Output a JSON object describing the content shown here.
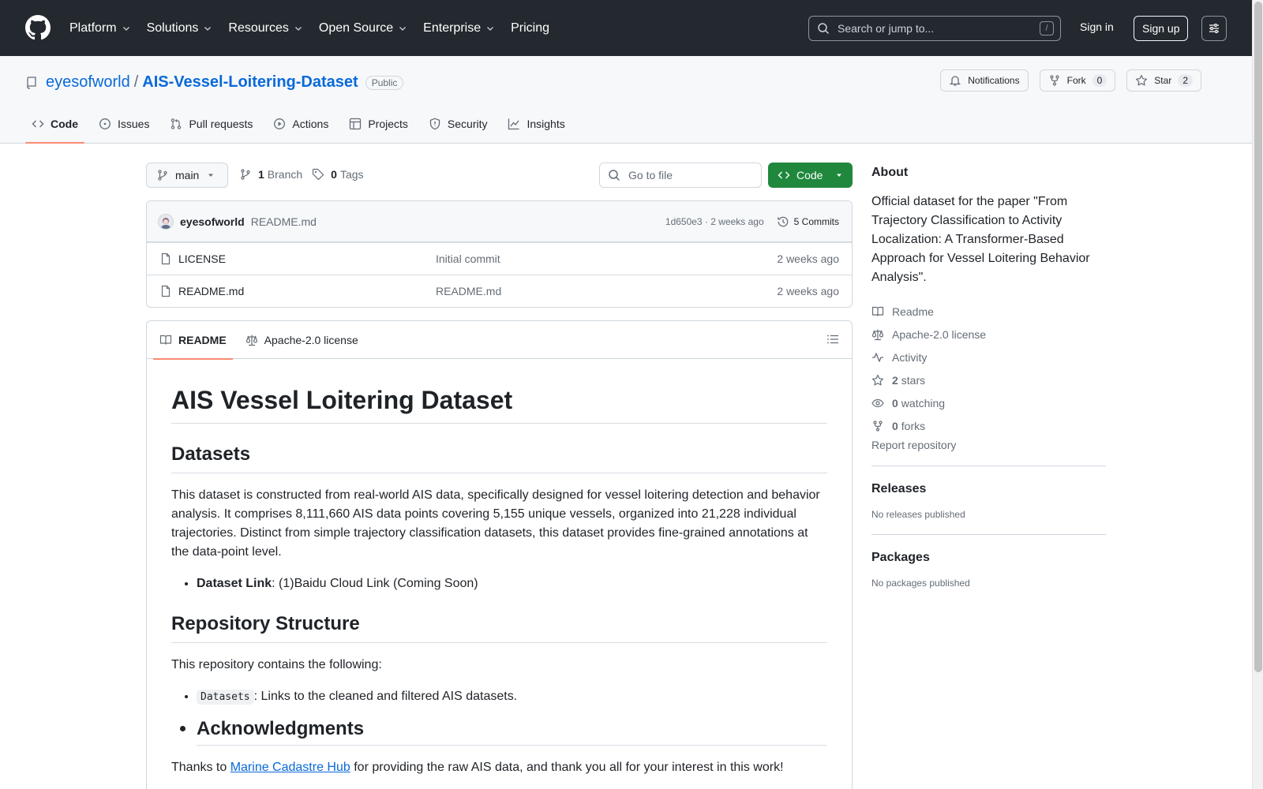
{
  "header": {
    "nav": [
      {
        "label": "Platform",
        "dropdown": true
      },
      {
        "label": "Solutions",
        "dropdown": true
      },
      {
        "label": "Resources",
        "dropdown": true
      },
      {
        "label": "Open Source",
        "dropdown": true
      },
      {
        "label": "Enterprise",
        "dropdown": true
      },
      {
        "label": "Pricing",
        "dropdown": false
      }
    ],
    "search_placeholder": "Search or jump to...",
    "search_shortcut": "/",
    "signin": "Sign in",
    "signup": "Sign up"
  },
  "repo": {
    "owner": "eyesofworld",
    "separator": "/",
    "name": "AIS-Vessel-Loitering-Dataset",
    "visibility": "Public",
    "notifications": "Notifications",
    "fork_label": "Fork",
    "fork_count": "0",
    "star_label": "Star",
    "star_count": "2",
    "tabs": [
      {
        "label": "Code",
        "icon": "code-icon"
      },
      {
        "label": "Issues",
        "icon": "issue-icon"
      },
      {
        "label": "Pull requests",
        "icon": "pull-request-icon"
      },
      {
        "label": "Actions",
        "icon": "play-icon"
      },
      {
        "label": "Projects",
        "icon": "table-icon"
      },
      {
        "label": "Security",
        "icon": "shield-icon"
      },
      {
        "label": "Insights",
        "icon": "graph-icon"
      }
    ]
  },
  "filenav": {
    "branch": "main",
    "branch_count": "1",
    "branch_label": "Branch",
    "tag_count": "0",
    "tag_label": "Tags",
    "goto_placeholder": "Go to file",
    "code_button": "Code"
  },
  "commit": {
    "author": "eyesofworld",
    "message": "README.md",
    "meta": "1d650e3 · 2 weeks ago",
    "commits": "5 Commits"
  },
  "files": [
    {
      "name": "LICENSE",
      "commit": "Initial commit",
      "age": "2 weeks ago"
    },
    {
      "name": "README.md",
      "commit": "README.md",
      "age": "2 weeks ago"
    }
  ],
  "readme": {
    "tab_readme": "README",
    "tab_license": "Apache-2.0 license",
    "title": "AIS Vessel Loitering Dataset",
    "h_datasets": "Datasets",
    "p_datasets": "This dataset is constructed from real-world AIS data, specifically designed for vessel loitering detection and behavior analysis. It comprises 8,111,660 AIS data points covering 5,155 unique vessels, organized into 21,228 individual trajectories. Distinct from simple trajectory classification datasets, this dataset provides fine-grained annotations at the data-point level.",
    "li_dataset_bold": "Dataset Link",
    "li_dataset_rest": ": (1)Baidu Cloud Link (Coming Soon)",
    "h_structure": "Repository Structure",
    "p_structure": "This repository contains the following:",
    "li_code": "Datasets",
    "li_code_rest": ": Links to the cleaned and filtered AIS datasets.",
    "h_ack": "Acknowledgments",
    "p_ack_pre": "Thanks to ",
    "p_ack_link": "Marine Cadastre Hub",
    "p_ack_post": " for providing the raw AIS data, and thank you all for your interest in this work!"
  },
  "sidebar": {
    "about_title": "About",
    "about_text": "Official dataset for the paper \"From Trajectory Classification to Activity Localization: A Transformer-Based Approach for Vessel Loitering Behavior Analysis\".",
    "readme": "Readme",
    "license": "Apache-2.0 license",
    "activity": "Activity",
    "stars_count": "2",
    "stars_label": "stars",
    "watching_count": "0",
    "watching_label": "watching",
    "forks_count": "0",
    "forks_label": "forks",
    "report": "Report repository",
    "releases_title": "Releases",
    "releases_note": "No releases published",
    "packages_title": "Packages",
    "packages_note": "No packages published"
  },
  "colors": {
    "header_bg": "#24292f",
    "link": "#0969da",
    "code_button": "#1f883d",
    "tab_underline": "#fd8c73"
  }
}
